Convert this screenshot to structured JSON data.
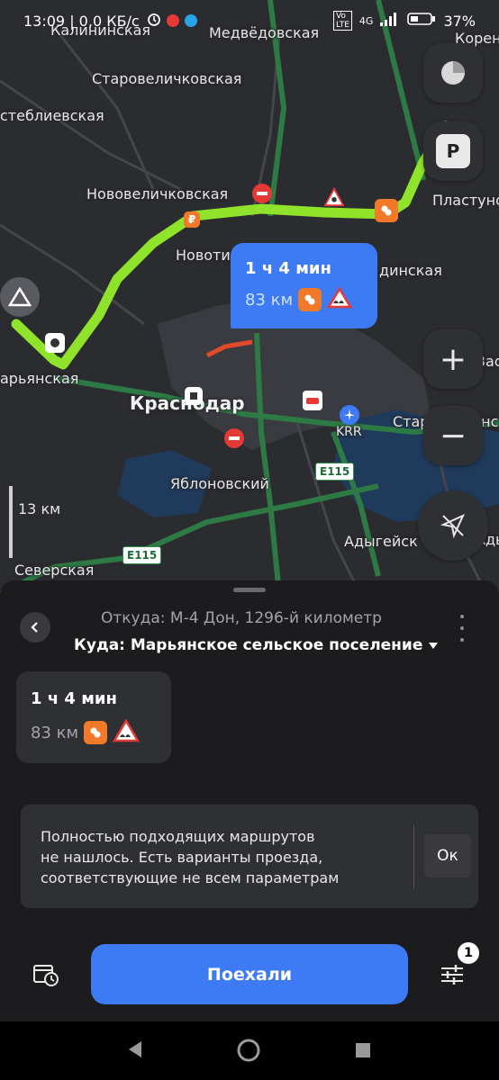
{
  "status_bar": {
    "time_and_speed": "13:09 | 0,0 КБ/с",
    "network": "4G",
    "battery": "37%"
  },
  "map": {
    "places": [
      "Калининская",
      "Медвёдовская",
      "Старовеличковская",
      "стеблиевская",
      "Нововеличковская",
      "Новоти",
      "Пластуно",
      "Корен",
      "динская",
      "Старокорсунс",
      "Адыгейск",
      "Яблоновский",
      "Северская",
      "арьянская",
      "Краснодар",
      "KRR",
      "Вас",
      "Адыгеж"
    ],
    "road_labels": [
      "E115",
      "E115"
    ],
    "scale_label": "13 км",
    "bubble": {
      "time": "1 ч 4 мин",
      "distance": "83 км"
    },
    "controls": {
      "parking_label": "P",
      "zoom_in": "+",
      "zoom_out": "−"
    }
  },
  "sheet": {
    "from": "Откуда: М-4 Дон, 1296-й километр",
    "to": "Куда: Марьянское сельское поселение",
    "route_card": {
      "time": "1 ч 4 мин",
      "distance": "83 км"
    },
    "notice": {
      "text_line1": "Полностью подходящих маршрутов",
      "text_line2": "не нашлось. Есть варианты проезда,",
      "text_line3": "соответствующие не всем параметрам",
      "ok_label": "Ок"
    },
    "go_label": "Поехали",
    "settings_badge": "1"
  },
  "colors": {
    "accent": "#3d7bf4",
    "route": "#8fe32a",
    "sheet_bg": "#1c1c1e",
    "card_bg": "#2f3034"
  }
}
